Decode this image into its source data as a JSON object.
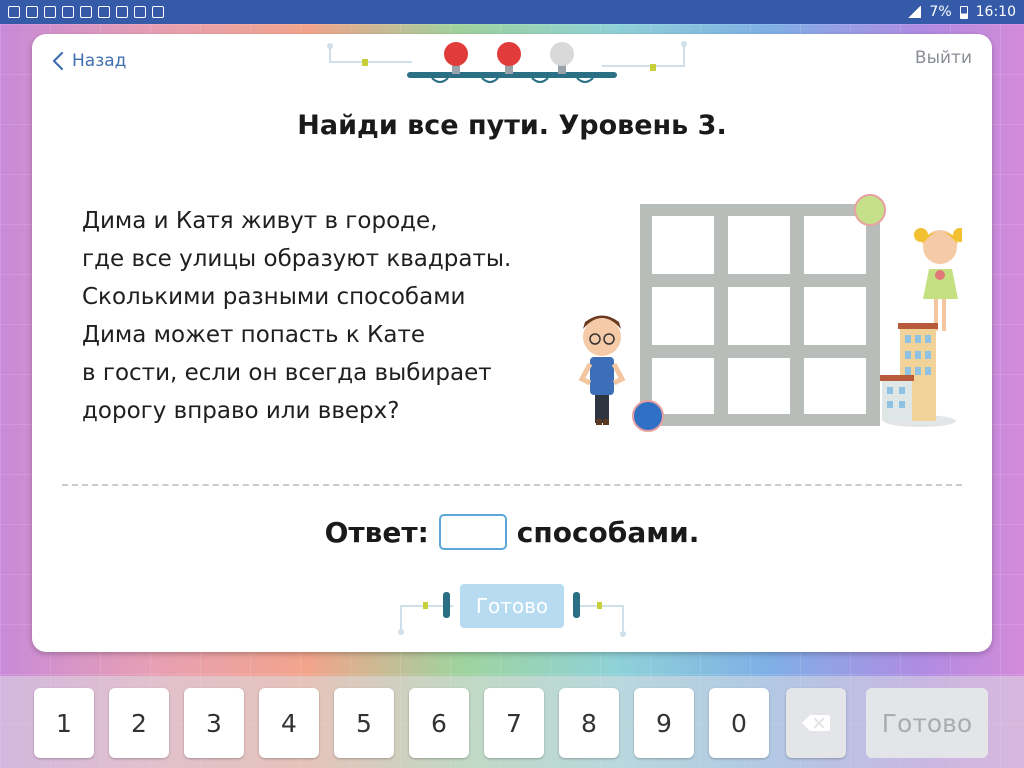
{
  "status_bar": {
    "battery": "7%",
    "time": "16:10"
  },
  "header": {
    "back_label": "Назад",
    "exit_label": "Выйти"
  },
  "title": "Найди все пути. Уровень 3.",
  "problem_lines": [
    "Дима и Катя живут в городе,",
    "где все улицы образуют квадраты.",
    "Сколькими разными способами",
    "Дима может попасть к Кате",
    "в гости, если он всегда выбирает",
    "дорогу вправо или вверх?"
  ],
  "answer": {
    "label": "Ответ:",
    "value": "",
    "suffix": "способами."
  },
  "ready_label": "Готово",
  "progress_lights": [
    "on",
    "on",
    "off"
  ],
  "colors": {
    "accent": "#3f6fb0",
    "status_bar": "#355aa8",
    "ready_disabled": "#b7dcf1",
    "light_on": "#e23b3b",
    "light_off": "#d9d9d9",
    "start_dot": "#2f6fc4",
    "end_dot": "#c6e08a"
  },
  "keypad": {
    "keys": [
      "1",
      "2",
      "3",
      "4",
      "5",
      "6",
      "7",
      "8",
      "9",
      "0"
    ],
    "backspace_icon": "backspace-icon",
    "done_label": "Готово"
  }
}
